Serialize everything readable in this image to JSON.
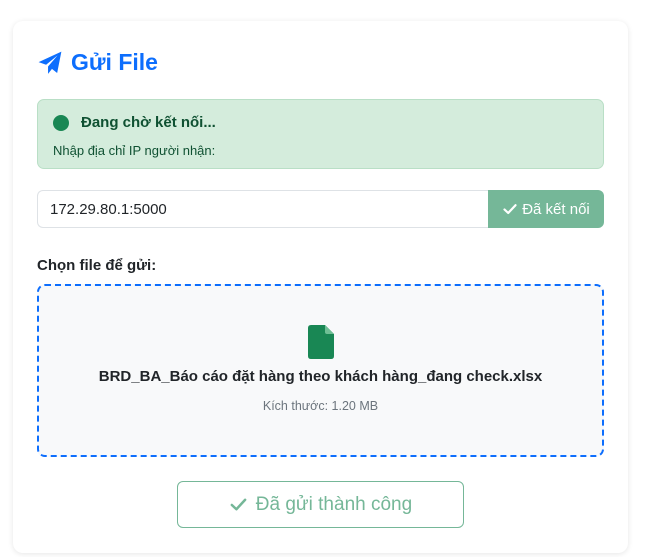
{
  "header": {
    "title": "Gửi File",
    "icon": "paper-plane-icon",
    "color": "#0d6efd"
  },
  "status": {
    "text": "Đang chờ kết nối...",
    "subtext": "Nhập địa chỉ IP người nhận:",
    "dot_color": "#198754",
    "background": "#d4ecdc"
  },
  "connection": {
    "ip_value": "172.29.80.1:5000",
    "button_label": "Đã kết nối",
    "button_icon": "check-icon",
    "button_color": "#75b798"
  },
  "file": {
    "label": "Chọn file để gửi:",
    "name": "BRD_BA_Báo cáo đặt hàng theo khách hàng_đang check.xlsx",
    "size": "Kích thước: 1.20 MB",
    "icon": "file-icon",
    "icon_color": "#198754",
    "border_color": "#0d6efd"
  },
  "send": {
    "label": "Đã gửi thành công",
    "icon": "check-icon",
    "color": "#75b798"
  }
}
